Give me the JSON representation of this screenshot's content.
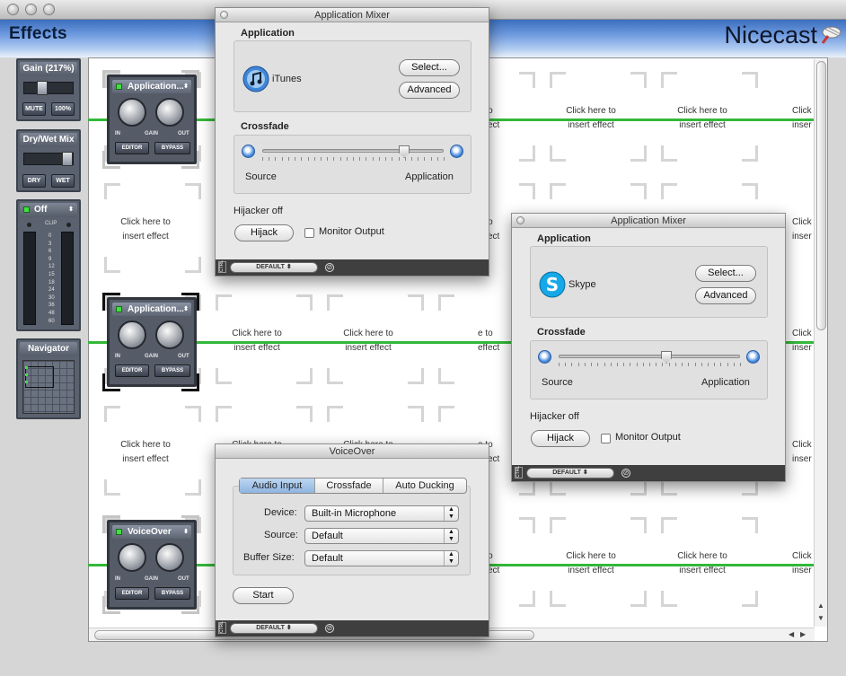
{
  "window": {
    "section_title": "Effects",
    "brand": "Nicecast"
  },
  "left_panels": {
    "gain": {
      "title": "Gain (217%)",
      "mute": "MUTE",
      "reset": "100%"
    },
    "drywet": {
      "title": "Dry/Wet Mix",
      "dry": "DRY",
      "wet": "WET"
    },
    "levels": {
      "title": "Off",
      "clip": "CLIP",
      "scale": [
        "0",
        "3",
        "6",
        "9",
        "12",
        "15",
        "18",
        "24",
        "30",
        "36",
        "48",
        "60"
      ]
    },
    "navigator": {
      "title": "Navigator"
    }
  },
  "effects": {
    "slot_text_line1": "Click here to",
    "slot_text_line2": "insert effect",
    "partial_slot_line1": "e to",
    "partial_slot_line2": "effect",
    "edge_slot_line1": "Click",
    "edge_slot_line2": "inser",
    "modules": [
      {
        "name": "Application...",
        "in": "IN",
        "gain": "GAIN",
        "out": "OUT",
        "editor": "EDITOR",
        "bypass": "BYPASS"
      },
      {
        "name": "Application...",
        "in": "IN",
        "gain": "GAIN",
        "out": "OUT",
        "editor": "EDITOR",
        "bypass": "BYPASS"
      },
      {
        "name": "VoiceOver",
        "in": "IN",
        "gain": "GAIN",
        "out": "OUT",
        "editor": "EDITOR",
        "bypass": "BYPASS"
      }
    ]
  },
  "mixer_itunes": {
    "title": "Application Mixer",
    "application_label": "Application",
    "app_name": "iTunes",
    "select_label": "Select...",
    "advanced_label": "Advanced",
    "crossfade_label": "Crossfade",
    "source_label": "Source",
    "application_end_label": "Application",
    "crossfade_value": 0.8,
    "hijacker_status": "Hijacker off",
    "hijack_label": "Hijack",
    "monitor_label": "Monitor Output",
    "monitor_checked": false,
    "preset": "DEFAULT",
    "ctrl_label": "CTRL"
  },
  "mixer_skype": {
    "title": "Application Mixer",
    "application_label": "Application",
    "app_name": "Skype",
    "select_label": "Select...",
    "advanced_label": "Advanced",
    "crossfade_label": "Crossfade",
    "source_label": "Source",
    "application_end_label": "Application",
    "crossfade_value": 0.6,
    "hijacker_status": "Hijacker off",
    "hijack_label": "Hijack",
    "monitor_label": "Monitor Output",
    "monitor_checked": false,
    "preset": "DEFAULT",
    "ctrl_label": "CTRL"
  },
  "voiceover": {
    "title": "VoiceOver",
    "tabs": [
      "Audio Input",
      "Crossfade",
      "Auto Ducking"
    ],
    "active_tab": "Audio Input",
    "device_label": "Device:",
    "device_value": "Built-in Microphone",
    "source_label": "Source:",
    "source_value": "Default",
    "buffer_label": "Buffer Size:",
    "buffer_value": "Default",
    "start_label": "Start",
    "preset": "DEFAULT",
    "ctrl_label": "CTRL"
  },
  "colors": {
    "accent_green": "#33b83a",
    "module_body": "#555c68",
    "header_blue": "#3c6fbe"
  }
}
